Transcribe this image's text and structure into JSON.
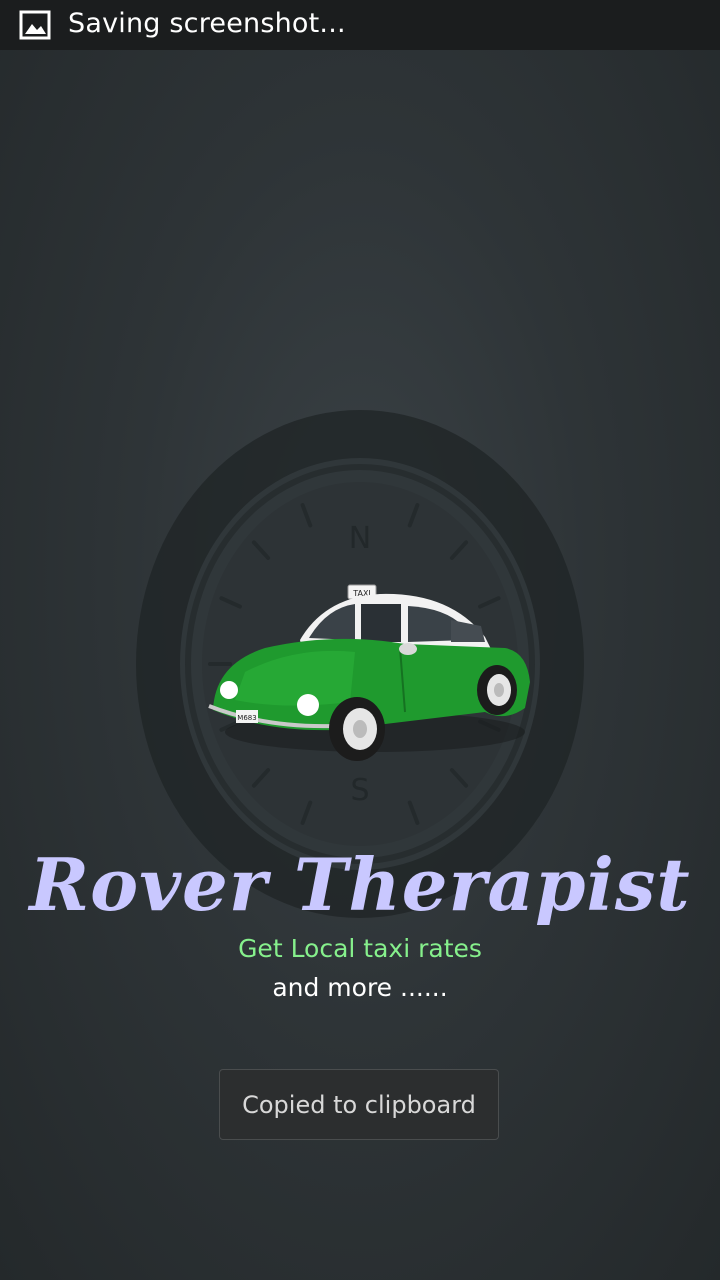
{
  "status_bar": {
    "icon": "image-icon",
    "text": "Saving screenshot..."
  },
  "splash": {
    "compass_north": "N",
    "compass_south": "S",
    "taxi_sign": "TAXI",
    "plate": "M683",
    "title": "Rover Therapist",
    "tagline": "Get Local taxi rates",
    "subtagline": "and more ......"
  },
  "toast": {
    "message": "Copied to clipboard"
  },
  "colors": {
    "title": "#c9c8ff",
    "tagline": "#86f08c",
    "car_green": "#1f9a2e"
  }
}
